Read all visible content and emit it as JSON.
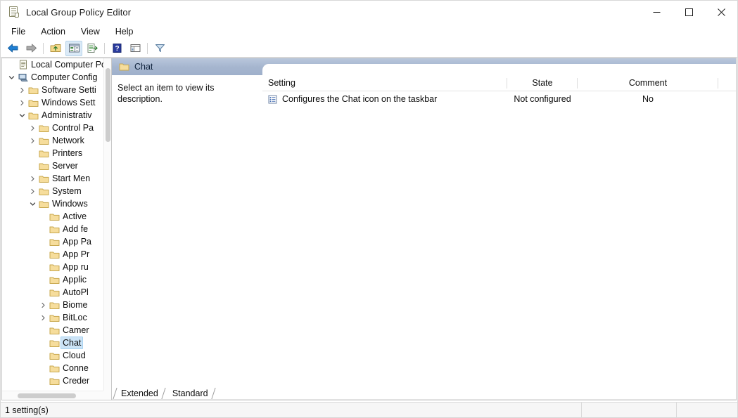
{
  "window": {
    "title": "Local Group Policy Editor",
    "icon": "gpedit-document-icon",
    "controls": {
      "minimize": "minimize-icon",
      "maximize": "maximize-icon",
      "close": "close-icon"
    }
  },
  "menu": {
    "items": [
      "File",
      "Action",
      "View",
      "Help"
    ]
  },
  "toolbar": {
    "buttons": [
      {
        "name": "back-button",
        "icon": "back-arrow-icon",
        "active": false
      },
      {
        "name": "forward-button",
        "icon": "forward-arrow-icon",
        "active": false
      },
      {
        "name": "up-one-level-button",
        "icon": "up-folder-icon",
        "active": false
      },
      {
        "name": "show-hide-console-tree-button",
        "icon": "console-tree-icon",
        "active": true
      },
      {
        "name": "export-list-button",
        "icon": "export-list-icon",
        "active": false
      },
      {
        "name": "help-button",
        "icon": "help-question-icon",
        "active": false
      },
      {
        "name": "properties-button",
        "icon": "properties-icon",
        "active": false
      },
      {
        "name": "filter-button",
        "icon": "filter-funnel-icon",
        "active": false
      }
    ]
  },
  "tree": {
    "nodes": [
      {
        "label": "Local Computer Poli",
        "indent": 0,
        "chevron": "none",
        "icon": "policy-document-icon",
        "selected": false
      },
      {
        "label": "Computer Config",
        "indent": 0,
        "chevron": "expanded",
        "icon": "computer-icon",
        "selected": false
      },
      {
        "label": "Software Setti",
        "indent": 1,
        "chevron": "collapsed",
        "icon": "folder-icon",
        "selected": false
      },
      {
        "label": "Windows Sett",
        "indent": 1,
        "chevron": "collapsed",
        "icon": "folder-icon",
        "selected": false
      },
      {
        "label": "Administrativ",
        "indent": 1,
        "chevron": "expanded",
        "icon": "folder-icon",
        "selected": false
      },
      {
        "label": "Control Pa",
        "indent": 2,
        "chevron": "collapsed",
        "icon": "folder-icon",
        "selected": false
      },
      {
        "label": "Network",
        "indent": 2,
        "chevron": "collapsed",
        "icon": "folder-icon",
        "selected": false
      },
      {
        "label": "Printers",
        "indent": 2,
        "chevron": "none",
        "icon": "folder-icon",
        "selected": false
      },
      {
        "label": "Server",
        "indent": 2,
        "chevron": "none",
        "icon": "folder-icon",
        "selected": false
      },
      {
        "label": "Start Men",
        "indent": 2,
        "chevron": "collapsed",
        "icon": "folder-icon",
        "selected": false
      },
      {
        "label": "System",
        "indent": 2,
        "chevron": "collapsed",
        "icon": "folder-icon",
        "selected": false
      },
      {
        "label": "Windows",
        "indent": 2,
        "chevron": "expanded",
        "icon": "folder-icon",
        "selected": false
      },
      {
        "label": "Active",
        "indent": 3,
        "chevron": "none",
        "icon": "folder-icon",
        "selected": false
      },
      {
        "label": "Add fe",
        "indent": 3,
        "chevron": "none",
        "icon": "folder-icon",
        "selected": false
      },
      {
        "label": "App Pa",
        "indent": 3,
        "chevron": "none",
        "icon": "folder-icon",
        "selected": false
      },
      {
        "label": "App Pr",
        "indent": 3,
        "chevron": "none",
        "icon": "folder-icon",
        "selected": false
      },
      {
        "label": "App ru",
        "indent": 3,
        "chevron": "none",
        "icon": "folder-icon",
        "selected": false
      },
      {
        "label": "Applic",
        "indent": 3,
        "chevron": "none",
        "icon": "folder-icon",
        "selected": false
      },
      {
        "label": "AutoPl",
        "indent": 3,
        "chevron": "none",
        "icon": "folder-icon",
        "selected": false
      },
      {
        "label": "Biome",
        "indent": 3,
        "chevron": "collapsed",
        "icon": "folder-icon",
        "selected": false
      },
      {
        "label": "BitLoc",
        "indent": 3,
        "chevron": "collapsed",
        "icon": "folder-icon",
        "selected": false
      },
      {
        "label": "Camer",
        "indent": 3,
        "chevron": "none",
        "icon": "folder-icon",
        "selected": false
      },
      {
        "label": "Chat",
        "indent": 3,
        "chevron": "none",
        "icon": "folder-icon",
        "selected": true
      },
      {
        "label": "Cloud",
        "indent": 3,
        "chevron": "none",
        "icon": "folder-icon",
        "selected": false
      },
      {
        "label": "Conne",
        "indent": 3,
        "chevron": "none",
        "icon": "folder-icon",
        "selected": false
      },
      {
        "label": "Creder",
        "indent": 3,
        "chevron": "none",
        "icon": "folder-icon",
        "selected": false
      }
    ]
  },
  "content": {
    "header_title": "Chat",
    "header_icon": "folder-icon",
    "description": "Select an item to view its description.",
    "columns": [
      "Setting",
      "State",
      "Comment"
    ],
    "rows": [
      {
        "icon": "policy-setting-icon",
        "setting": "Configures the Chat icon on the taskbar",
        "state": "Not configured",
        "comment": "No"
      }
    ],
    "tabs": [
      {
        "label": "Extended",
        "active": false
      },
      {
        "label": "Standard",
        "active": true
      }
    ]
  },
  "statusbar": {
    "text": "1 setting(s)",
    "panel2": "",
    "panel3": ""
  }
}
